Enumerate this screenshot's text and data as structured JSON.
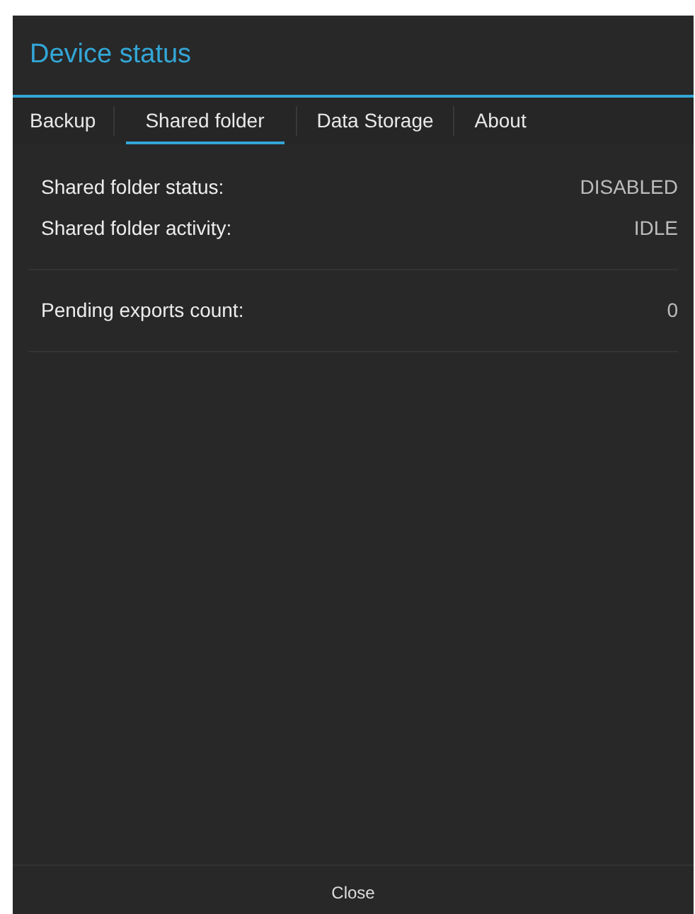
{
  "dialog": {
    "title": "Device status"
  },
  "tabs": [
    {
      "label": "Backup",
      "selected": false
    },
    {
      "label": "Shared folder",
      "selected": true
    },
    {
      "label": "Data Storage",
      "selected": false
    },
    {
      "label": "About",
      "selected": false
    }
  ],
  "sections": [
    {
      "rows": [
        {
          "label": "Shared folder status:",
          "value": "DISABLED"
        },
        {
          "label": "Shared folder activity:",
          "value": "IDLE"
        }
      ]
    },
    {
      "rows": [
        {
          "label": "Pending exports count:",
          "value": "0"
        }
      ]
    }
  ],
  "buttons": [
    "Close"
  ]
}
